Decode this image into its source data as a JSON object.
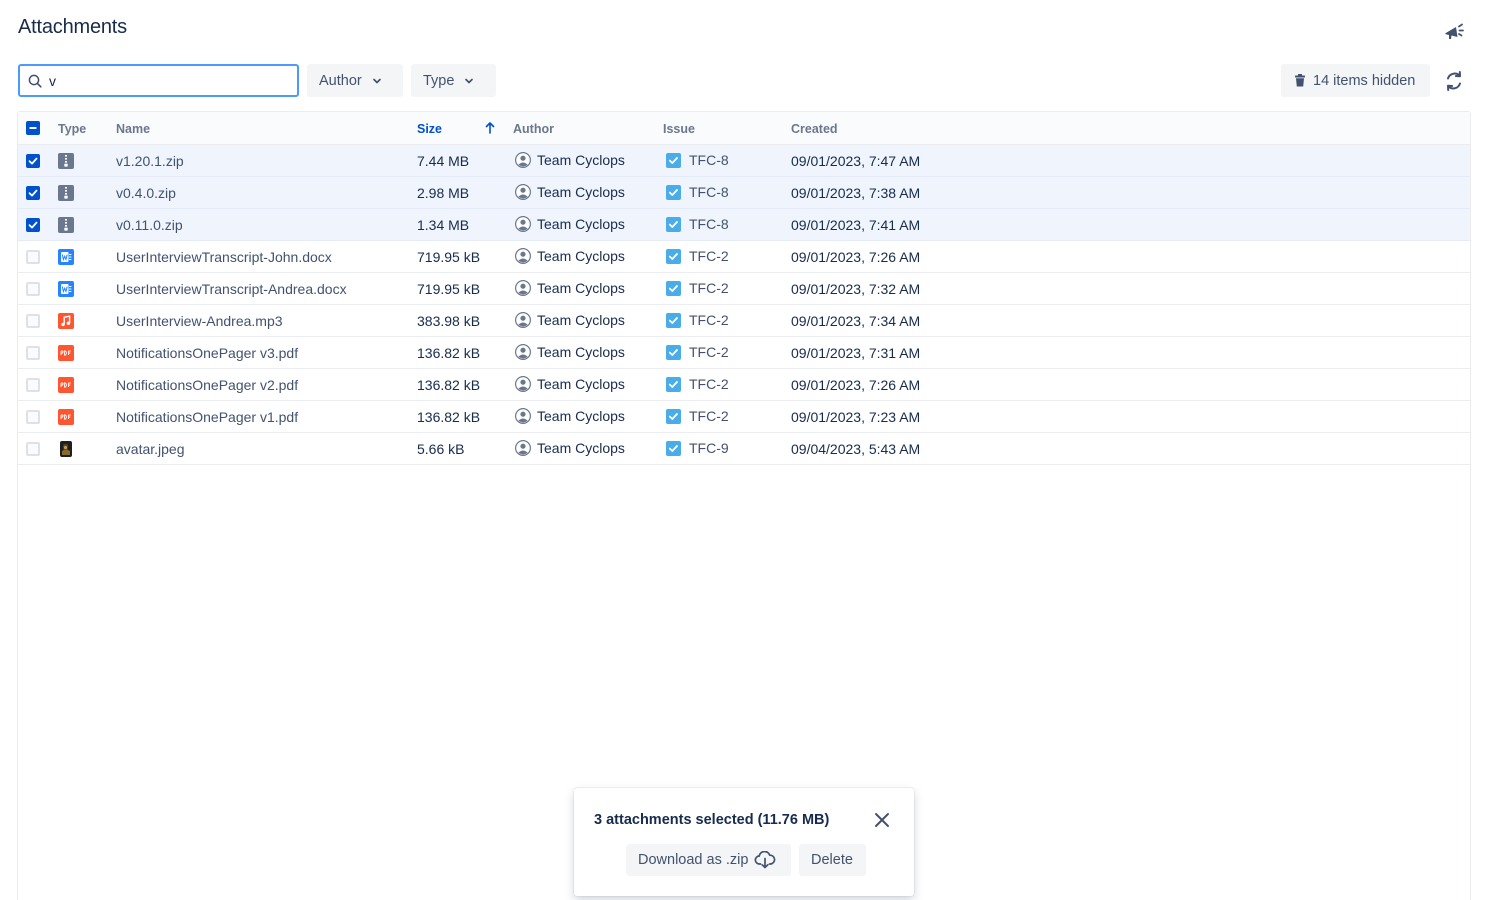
{
  "header": {
    "title": "Attachments",
    "feedback_icon": "megaphone-icon"
  },
  "toolbar": {
    "search_value": "v",
    "search_icon": "search-icon",
    "author_label": "Author",
    "type_label": "Type",
    "hidden_label": "14 items hidden",
    "refresh_icon": "refresh-icon"
  },
  "table": {
    "columns": [
      "Type",
      "Name",
      "Size",
      "Author",
      "Issue",
      "Created"
    ],
    "sorted_column": "Size",
    "sort_direction": "ascending",
    "rows": [
      {
        "selected": true,
        "type": "zip",
        "name": "v1.20.1.zip",
        "size": "7.44 MB",
        "author": "Team Cyclops",
        "issue": "TFC-8",
        "created": "09/01/2023, 7:47 AM"
      },
      {
        "selected": true,
        "type": "zip",
        "name": "v0.4.0.zip",
        "size": "2.98 MB",
        "author": "Team Cyclops",
        "issue": "TFC-8",
        "created": "09/01/2023, 7:38 AM"
      },
      {
        "selected": true,
        "type": "zip",
        "name": "v0.11.0.zip",
        "size": "1.34 MB",
        "author": "Team Cyclops",
        "issue": "TFC-8",
        "created": "09/01/2023, 7:41 AM"
      },
      {
        "selected": false,
        "type": "word",
        "name": "UserInterviewTranscript-John.docx",
        "size": "719.95 kB",
        "author": "Team Cyclops",
        "issue": "TFC-2",
        "created": "09/01/2023, 7:26 AM"
      },
      {
        "selected": false,
        "type": "word",
        "name": "UserInterviewTranscript-Andrea.docx",
        "size": "719.95 kB",
        "author": "Team Cyclops",
        "issue": "TFC-2",
        "created": "09/01/2023, 7:32 AM"
      },
      {
        "selected": false,
        "type": "audio",
        "name": "UserInterview-Andrea.mp3",
        "size": "383.98 kB",
        "author": "Team Cyclops",
        "issue": "TFC-2",
        "created": "09/01/2023, 7:34 AM"
      },
      {
        "selected": false,
        "type": "pdf",
        "name": "NotificationsOnePager v3.pdf",
        "size": "136.82 kB",
        "author": "Team Cyclops",
        "issue": "TFC-2",
        "created": "09/01/2023, 7:31 AM"
      },
      {
        "selected": false,
        "type": "pdf",
        "name": "NotificationsOnePager v2.pdf",
        "size": "136.82 kB",
        "author": "Team Cyclops",
        "issue": "TFC-2",
        "created": "09/01/2023, 7:26 AM"
      },
      {
        "selected": false,
        "type": "pdf",
        "name": "NotificationsOnePager v1.pdf",
        "size": "136.82 kB",
        "author": "Team Cyclops",
        "issue": "TFC-2",
        "created": "09/01/2023, 7:23 AM"
      },
      {
        "selected": false,
        "type": "image",
        "name": "avatar.jpeg",
        "size": "5.66 kB",
        "author": "Team Cyclops",
        "issue": "TFC-9",
        "created": "09/04/2023, 5:43 AM"
      }
    ]
  },
  "selection_popup": {
    "title": "3 attachments selected (11.76 MB)",
    "download_label": "Download as .zip",
    "download_icon": "cloud-download-icon",
    "delete_label": "Delete",
    "close_icon": "close-icon"
  },
  "colors": {
    "primary": "#0052cc",
    "focus": "#4c9aff",
    "selected_row": "#f0f5fd",
    "word": "#2684ff",
    "pdf": "#ff5630",
    "audio": "#ff5630",
    "zip": "#6b778c",
    "issue_check": "#4bade8"
  }
}
